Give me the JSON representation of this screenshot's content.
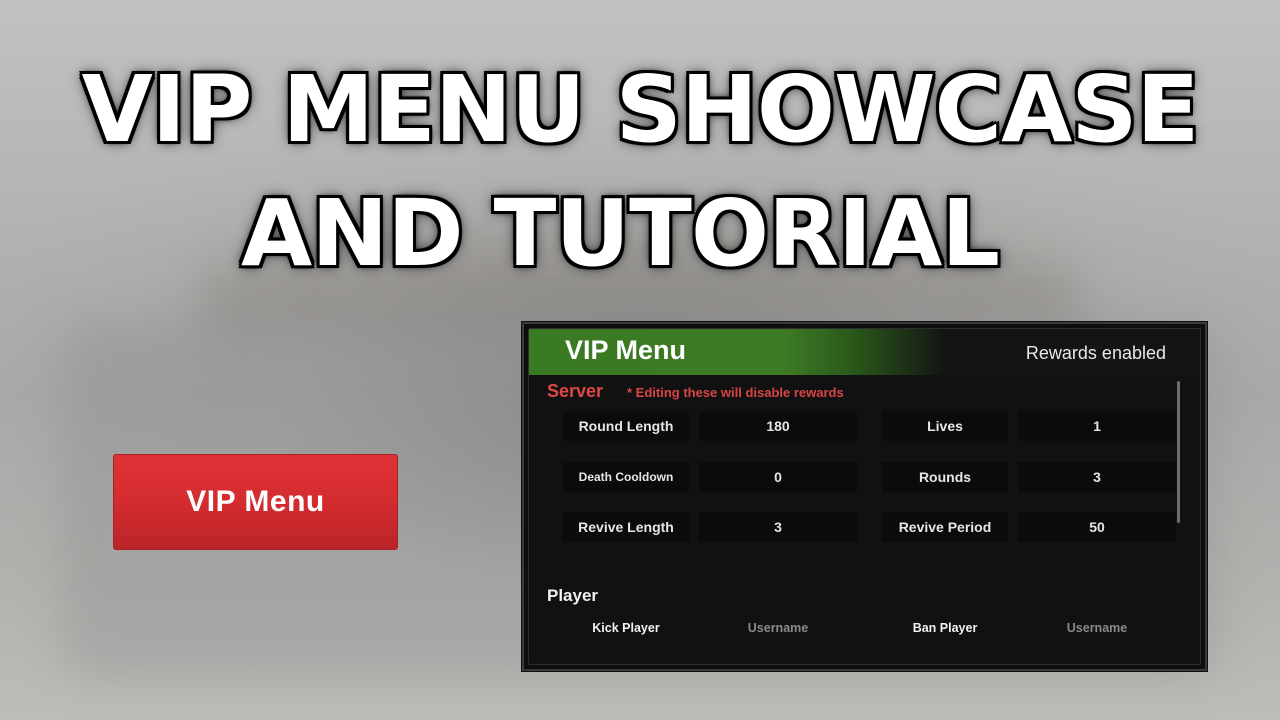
{
  "thumbnail": {
    "title_line1": "VIP MENU SHOWCASE",
    "title_line2": "AND TUTORIAL"
  },
  "open_button": {
    "label": "VIP Menu",
    "color": "#d92d31"
  },
  "vip_menu": {
    "title": "VIP Menu",
    "rewards_status": "Rewards enabled",
    "accent_color": "#3a7a22",
    "warning_color": "#e04848",
    "server": {
      "heading": "Server",
      "warning": "* Editing these will disable rewards",
      "settings": [
        {
          "label": "Round Length",
          "value": "180"
        },
        {
          "label": "Lives",
          "value": "1"
        },
        {
          "label": "Death Cooldown",
          "value": "0"
        },
        {
          "label": "Rounds",
          "value": "3"
        },
        {
          "label": "Revive Length",
          "value": "3"
        },
        {
          "label": "Revive Period",
          "value": "50"
        }
      ]
    },
    "player": {
      "heading": "Player",
      "actions": [
        {
          "label": "Kick Player",
          "placeholder": "Username"
        },
        {
          "label": "Ban Player",
          "placeholder": "Username"
        }
      ]
    }
  }
}
